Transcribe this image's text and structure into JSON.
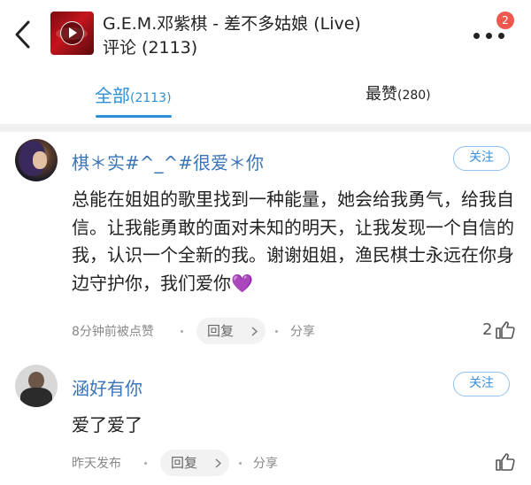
{
  "header": {
    "title": "G.E.M.邓紫棋 - 差不多姑娘 (Live)",
    "comment_count_label": "评论 (2113)",
    "notification_badge": "2"
  },
  "tabs": [
    {
      "label": "全部",
      "count": "(2113)",
      "active": true
    },
    {
      "label": "最赞",
      "count": "(280)",
      "active": false
    }
  ],
  "accent_color": "#2f8fd6",
  "comments": [
    {
      "username": "棋＊实#^_^#很爱＊你",
      "follow_label": "关注",
      "text": "总能在姐姐的歌里找到一种能量，她会给我勇气，给我自信。让我能勇敢的面对未知的明天，让我发现一个自信的我，认识一个全新的我。谢谢姐姐，渔民棋士永远在你身边守护你，我们爱你💜",
      "time": "8分钟前被点赞",
      "reply_label": "回复",
      "share_label": "分享",
      "like_count": "2"
    },
    {
      "username": "涵好有你",
      "follow_label": "关注",
      "text": "爱了爱了",
      "time": "昨天发布",
      "reply_label": "回复",
      "share_label": "分享",
      "like_count": ""
    }
  ]
}
